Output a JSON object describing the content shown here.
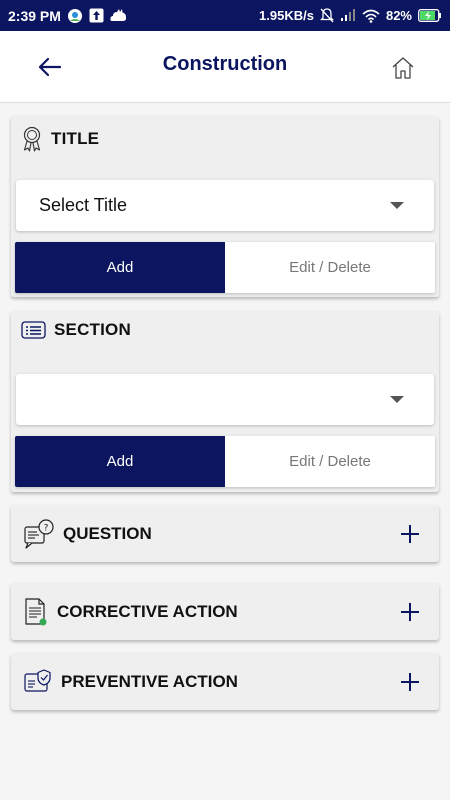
{
  "status_bar": {
    "time": "2:39 PM",
    "network_speed": "1.95KB/s",
    "battery": "82%"
  },
  "header": {
    "title": "Construction"
  },
  "title_section": {
    "label": "TITLE",
    "dropdown_value": "Select Title",
    "add_label": "Add",
    "edit_label": "Edit / Delete"
  },
  "section_section": {
    "label": "SECTION",
    "dropdown_value": "",
    "add_label": "Add",
    "edit_label": "Edit / Delete"
  },
  "question": {
    "label": "QUESTION"
  },
  "corrective": {
    "label": "CORRECTIVE ACTION"
  },
  "preventive": {
    "label": "PREVENTIVE ACTION"
  },
  "colors": {
    "primary": "#0b1560",
    "card": "#efefef"
  }
}
